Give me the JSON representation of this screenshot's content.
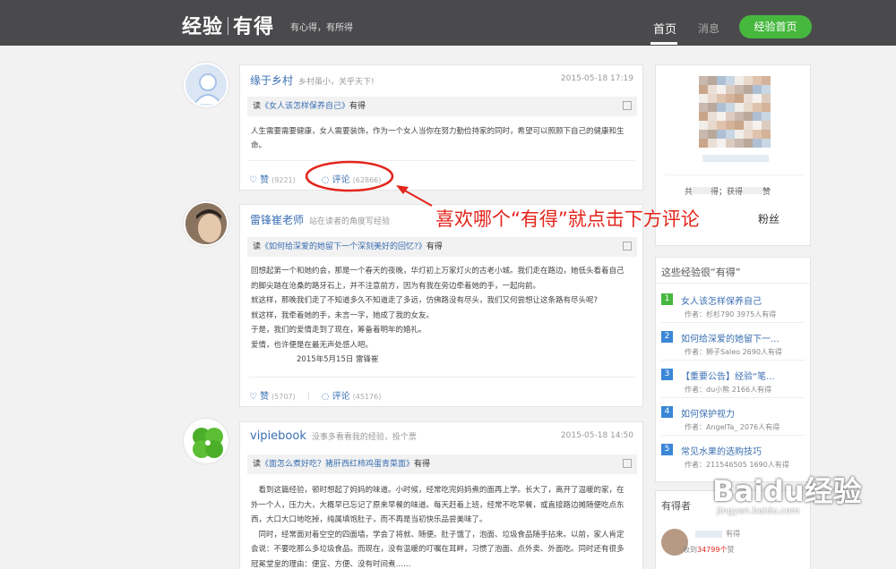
{
  "topbar": {
    "logo_left": "经验",
    "logo_right": "有得",
    "slogan": "有心得，有所得",
    "nav_home": "首页",
    "nav_messages": "消息",
    "btn_experience_home": "经验首页"
  },
  "posts": [
    {
      "user": "缘于乡村",
      "user_sub": "乡村虽小，关乎天下!",
      "time": "2015-05-18 17:19",
      "read_prefix": "读",
      "read_title": "《女人该怎样保养自己》",
      "read_suffix": "有得",
      "body": [
        "人生需要需要健康，女人需要装饰，作为一个女人当你在努力勤俭持家的同时，希望可以照顾下自己的健康和生命。"
      ],
      "like_label": "赞",
      "like_count": "(9221)",
      "comment_label": "评论",
      "comment_count": "(62866)"
    },
    {
      "user": "雷锋崔老师",
      "user_sub": "站在读者的角度写经验",
      "read_prefix": "读",
      "read_title": "《如何给深爱的她留下一个深刻美好的回忆?》",
      "read_suffix": "有得",
      "body": [
        "回想起第一个和她约会，那是一个春天的夜晚，华灯初上万家灯火的古老小城。我们走在路边，她低头看着自己",
        "的脚尖踏在沧桑的路牙石上，并不注意前方，因为有我在旁边牵着她的手，一起向前。",
        "就这样，那晚我们走了不知道多久不知道走了多远，仿佛路没有尽头，我们又何尝想让这条路有尽头呢?",
        "就这样，我牵着她的手，未言一字，她成了我的女友。",
        "于是，我们的爱情走到了现在，筹备着明年的婚礼。",
        "爱情，也许便是在最无声处感人吧。",
        "　　　　　　2015年5月15日 雷锋崔"
      ],
      "like_label": "赞",
      "like_count": "(5707)",
      "comment_label": "评论",
      "comment_count": "(45176)"
    },
    {
      "user": "vipiebook",
      "user_sub": "没事多看看我的经验，投个票",
      "time": "2015-05-18 14:50",
      "read_prefix": "读",
      "read_title": "《面怎么煮好吃？猪肝西红柿鸡蛋青菜面》",
      "read_suffix": "有得",
      "body": [
        "　看到这篇经验，顿时想起了妈妈的味道。小时候，经常吃完妈妈煮的面再上学。长大了，离开了温暖的家，在",
        "外一个人，压力大，大概早已忘记了原来早餐的味道。每天赶着上班，经常不吃早餐，或直接路边摊随便吃点东",
        "西，大口大口地吃掉，纯属填饱肚子，而不再是当初快乐品尝美味了。",
        "　同时，经常面对着空空的四面墙，学会了将就、随便。肚子饿了，泡面、垃圾食品随手拈来。以前，家人肯定",
        "会说：不要吃那么多垃圾食品。而现在，没有温暖的叮嘱在耳畔，习惯了泡面、点外卖、外面吃。同时还有很多",
        "冠冕堂皇的理由：便宜、方便、没有时间煮……"
      ]
    }
  ],
  "annotation": "喜欢哪个“有得”就点击下方评论",
  "profile": {
    "stats_left": "共",
    "stats_mid": "得；获得",
    "stats_right": "赞",
    "fans_label": "粉丝"
  },
  "ranking": {
    "title": "这些经验很“有得”",
    "items": [
      {
        "num": "1",
        "title": "女人该怎样保养自己",
        "author": "作者：杉杉790",
        "count": "3975人有得",
        "color": "#46b83e"
      },
      {
        "num": "2",
        "title": "如何给深爱的她留下一...",
        "author": "作者：狮子Saleo",
        "count": "2690人有得",
        "color": "#3a87d6"
      },
      {
        "num": "3",
        "title": "【重要公告】经验“笔...",
        "author": "作者：du小熊",
        "count": "2166人有得",
        "color": "#3a87d6"
      },
      {
        "num": "4",
        "title": "如何保护视力",
        "author": "作者：AngelTa_",
        "count": "2076人有得",
        "color": "#3a87d6"
      },
      {
        "num": "5",
        "title": "常见水果的选购技巧",
        "author": "作者：211546505",
        "count": "1690人有得",
        "color": "#3a87d6"
      }
    ]
  },
  "sidebar3": {
    "title": "有得者",
    "fav_prefix": "收到",
    "fav_count": "34799个",
    "fav_suffix": "赞",
    "partial": "有得"
  },
  "watermark": {
    "brand": "Baidu经验",
    "url": "jingyan.baidu.com"
  },
  "colors": {
    "accent": "#46b83e",
    "link": "#3a6fb2",
    "annotation": "#e3251c"
  }
}
